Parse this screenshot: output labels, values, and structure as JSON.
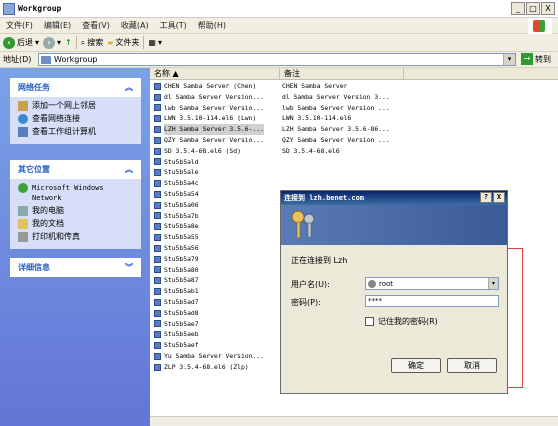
{
  "window": {
    "title": "Workgroup",
    "controls": [
      "_",
      "□",
      "X"
    ]
  },
  "menu": [
    "文件(F)",
    "编辑(E)",
    "查看(V)",
    "收藏(A)",
    "工具(T)",
    "帮助(H)"
  ],
  "toolbar": {
    "back": "后退",
    "search": "搜索",
    "folders": "文件夹"
  },
  "address": {
    "label": "地址(D)",
    "value": "Workgroup",
    "go": "转到"
  },
  "left": {
    "network_tasks": {
      "title": "网络任务",
      "items": [
        "添加一个网上邻居",
        "查看网络连接",
        "查看工作组计算机"
      ]
    },
    "other_places": {
      "title": "其它位置",
      "items": [
        "Microsoft Windows Network",
        "我的电脑",
        "我的文档",
        "打印机和传真"
      ]
    },
    "details": {
      "title": "详细信息"
    }
  },
  "columns": {
    "name": "名称",
    "comment": "备注"
  },
  "rows": [
    {
      "name": "CHEN Samba Server (Chen)",
      "comment": "CHEN Samba Server"
    },
    {
      "name": "dl Samba Server Version...",
      "comment": "dl Samba Server Version 3..."
    },
    {
      "name": "lwb Samba Server Versio...",
      "comment": "lwb Samba Server Version ..."
    },
    {
      "name": "LWN 3.5.10-114.el6 (Lwn)",
      "comment": "LWN 3.5.10-114.el6"
    },
    {
      "name": "LZH Samba Server 3.5.6-...",
      "comment": "LZH Samba Server 3.5.6-86..."
    },
    {
      "name": "QZY Samba Server Versio...",
      "comment": "QZY Samba Server Version ..."
    },
    {
      "name": "SD 3.5.4-68.el6 (Sd)",
      "comment": "SD 3.5.4-68.el6"
    },
    {
      "name": "Stu5b5ald",
      "comment": ""
    },
    {
      "name": "Stu5b5ale",
      "comment": ""
    },
    {
      "name": "Stu5b5a4c",
      "comment": ""
    },
    {
      "name": "Stu5b5a54",
      "comment": ""
    },
    {
      "name": "Stu5b5a06",
      "comment": ""
    },
    {
      "name": "Stu5b5a7b",
      "comment": ""
    },
    {
      "name": "Stu5b5a8e",
      "comment": ""
    },
    {
      "name": "Stu5b5a55",
      "comment": ""
    },
    {
      "name": "Stu5b5a56",
      "comment": ""
    },
    {
      "name": "Stu5b5a79",
      "comment": ""
    },
    {
      "name": "Stu5b5a80",
      "comment": ""
    },
    {
      "name": "Stu5b5a87",
      "comment": ""
    },
    {
      "name": "Stu5b5ab1",
      "comment": ""
    },
    {
      "name": "Stu5b5ad7",
      "comment": ""
    },
    {
      "name": "Stu5b5ad8",
      "comment": ""
    },
    {
      "name": "Stu5b5ae7",
      "comment": ""
    },
    {
      "name": "Stu5b5aeb",
      "comment": ""
    },
    {
      "name": "Stu5b5aef",
      "comment": ""
    },
    {
      "name": "Yu Samba Server Version...",
      "comment": ""
    },
    {
      "name": "ZLP 3.5.4-68.el6 (Zlp)",
      "comment": "ZLP 3.5.4-68.el6"
    }
  ],
  "dialog": {
    "title": "连接到 lzh.benet.com",
    "connecting": "正在连接到 Lzh",
    "user_label": "用户名(U):",
    "user_value": "root",
    "pass_label": "密码(P):",
    "pass_value": "****",
    "remember": "记住我的密码(R)",
    "ok": "确定",
    "cancel": "取消",
    "controls": [
      "?",
      "X"
    ]
  }
}
